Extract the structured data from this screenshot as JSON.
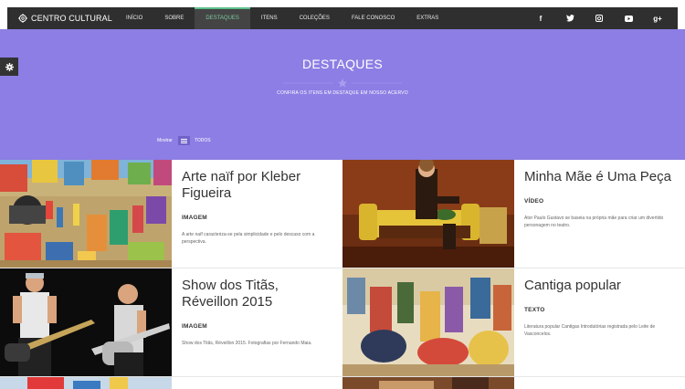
{
  "brand": {
    "name": "CENTRO CULTURAL",
    "icon": "gear-logo-icon"
  },
  "nav": {
    "items": [
      {
        "label": "INÍCIO",
        "active": false
      },
      {
        "label": "SOBRE",
        "active": false
      },
      {
        "label": "DESTAQUES",
        "active": true
      },
      {
        "label": "ITENS",
        "active": false
      },
      {
        "label": "COLEÇÕES",
        "active": false
      },
      {
        "label": "FALE CONOSCO",
        "active": false
      },
      {
        "label": "EXTRAS",
        "active": false
      }
    ],
    "social": [
      {
        "icon": "facebook-icon",
        "glyph": "f"
      },
      {
        "icon": "twitter-icon",
        "glyph": "t"
      },
      {
        "icon": "instagram-icon",
        "glyph": "◙"
      },
      {
        "icon": "youtube-icon",
        "glyph": "▶"
      },
      {
        "icon": "google-plus-icon",
        "glyph": "g+"
      }
    ]
  },
  "hero": {
    "title": "DESTAQUES",
    "subtitle": "CONFIRA OS ITENS EM DESTAQUE EM NOSSO ACERVO",
    "filter_label": "Mostrar",
    "filter_value": "TODOS"
  },
  "cards": [
    {
      "title": "Arte naïf por Kleber Figueira",
      "type": "IMAGEM",
      "desc": "A arte naïf caracteriza-se pela simplicidade e pelo descaso com a perspectiva."
    },
    {
      "title": "Minha Mãe é Uma Peça",
      "type": "VÍDEO",
      "desc": "Ator Paulo Gustavo se baseia na própria mãe para criar um divertido personagem no teatro."
    },
    {
      "title": "Show dos Titãs, Réveillon 2015",
      "type": "IMAGEM",
      "desc": "Show dos Titãs, Réveillon 2015. Fotografias por Fernando Maia."
    },
    {
      "title": "Cantiga popular",
      "type": "TEXTO",
      "desc": "Literatura popular Cantigas Introdutórias registrada pelo Leite de Vasconcelos."
    }
  ],
  "colors": {
    "hero": "#8c7ee4",
    "nav": "#2f2f2f",
    "accent": "#5bbf8a"
  }
}
